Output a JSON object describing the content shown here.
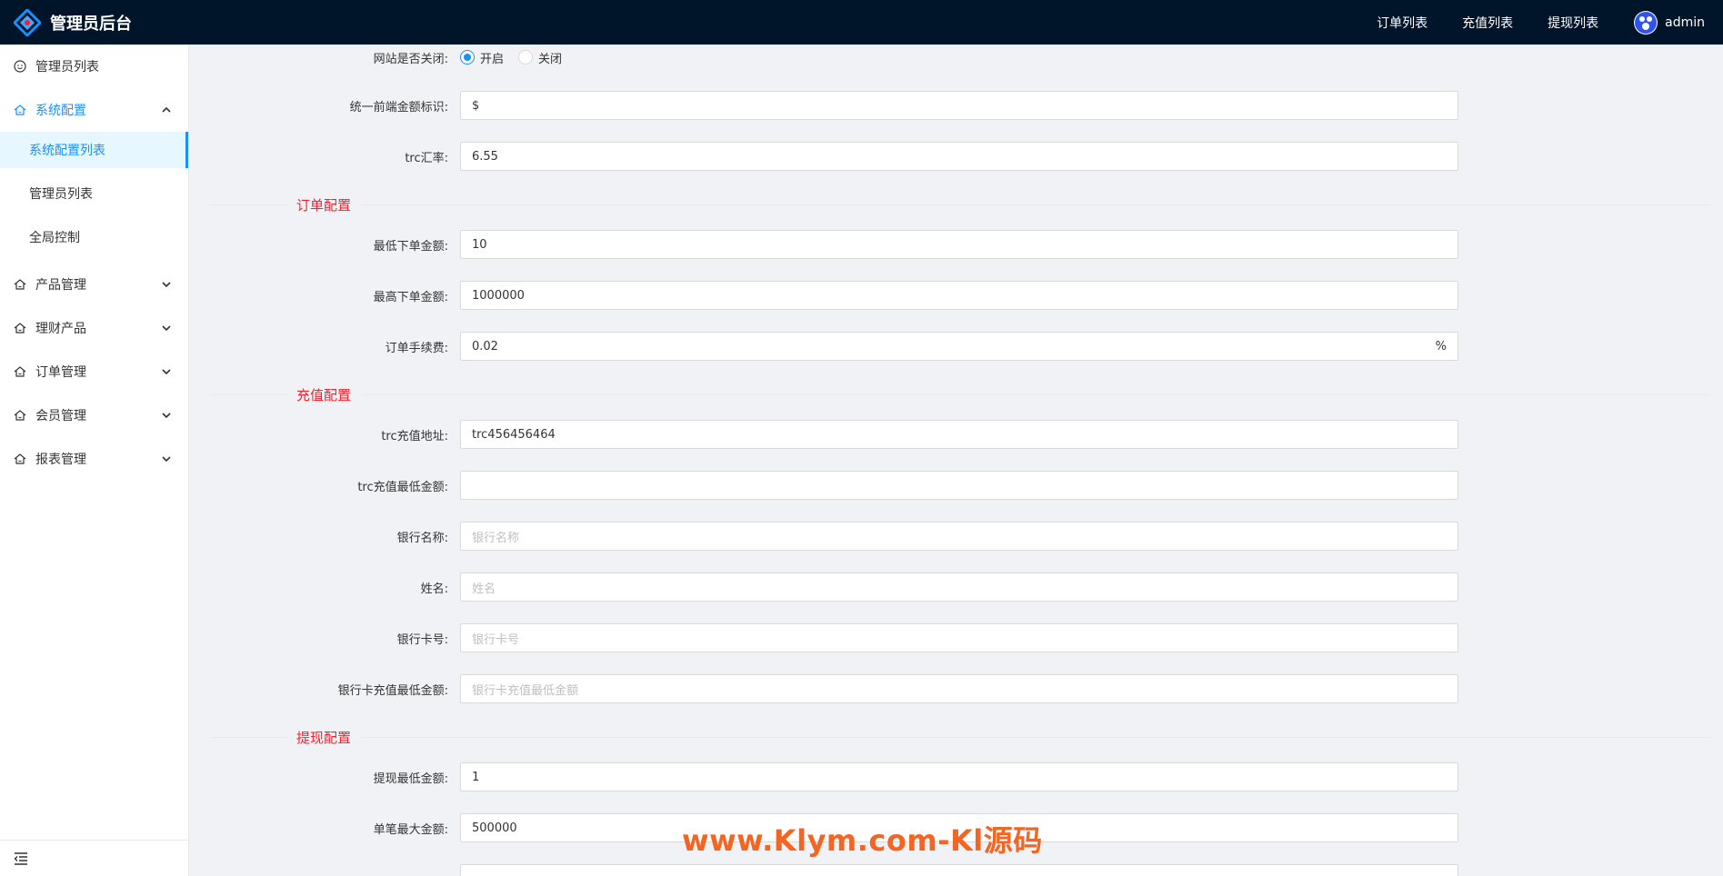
{
  "header": {
    "title": "管理员后台",
    "nav": [
      "订单列表",
      "充值列表",
      "提现列表"
    ],
    "user": "admin"
  },
  "sidebar": {
    "items": [
      {
        "label": "管理员列表",
        "icon": "smile-icon"
      },
      {
        "label": "系统配置",
        "icon": "home-icon",
        "expanded": true,
        "children": [
          "系统配置列表",
          "管理员列表",
          "全局控制"
        ],
        "selected_child": "系统配置列表"
      },
      {
        "label": "产品管理",
        "icon": "home-icon"
      },
      {
        "label": "理财产品",
        "icon": "home-icon"
      },
      {
        "label": "订单管理",
        "icon": "home-icon"
      },
      {
        "label": "会员管理",
        "icon": "home-icon"
      },
      {
        "label": "报表管理",
        "icon": "home-icon"
      }
    ]
  },
  "form": {
    "site_close": {
      "label": "网站是否关闭:",
      "options": [
        "开启",
        "关闭"
      ],
      "selected": "开启"
    },
    "currency_symbol": {
      "label": "统一前端金额标识:",
      "value": "$"
    },
    "trc_rate": {
      "label": "trc汇率:",
      "value": "6.55"
    },
    "sections": {
      "order": "订单配置",
      "recharge": "充值配置",
      "withdraw": "提现配置"
    },
    "min_order": {
      "label": "最低下单金额:",
      "value": "10"
    },
    "max_order": {
      "label": "最高下单金额:",
      "value": "1000000"
    },
    "order_fee": {
      "label": "订单手续费:",
      "value": "0.02",
      "suffix": "%"
    },
    "trc_address": {
      "label": "trc充值地址:",
      "value": "trc456456464"
    },
    "trc_min": {
      "label": "trc充值最低金额:",
      "value": ""
    },
    "bank_name": {
      "label": "银行名称:",
      "placeholder": "银行名称"
    },
    "holder_name": {
      "label": "姓名:",
      "placeholder": "姓名"
    },
    "card_no": {
      "label": "银行卡号:",
      "placeholder": "银行卡号"
    },
    "card_min": {
      "label": "银行卡充值最低金额:",
      "placeholder": "银行卡充值最低金额"
    },
    "withdraw_min": {
      "label": "提现最低金额:",
      "value": "1"
    },
    "withdraw_max": {
      "label": "单笔最大金额:",
      "value": "500000"
    }
  },
  "watermark": "www.Klym.com-Kl源码",
  "colors": {
    "header_bg": "#001529",
    "accent": "#1890ff",
    "section_title": "#f5222d",
    "watermark": "#f26522"
  }
}
